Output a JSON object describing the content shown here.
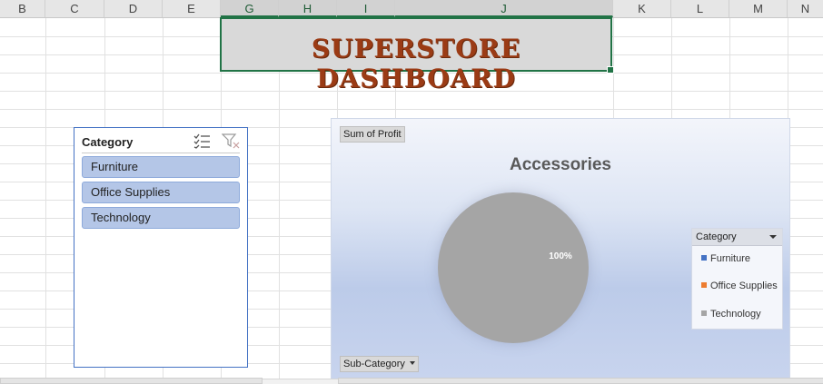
{
  "columns": [
    "B",
    "C",
    "D",
    "E",
    "G",
    "H",
    "I",
    "J",
    "K",
    "L",
    "M",
    "N"
  ],
  "selected_columns": [
    "G",
    "H",
    "I",
    "J"
  ],
  "title": "SUPERSTORE DASHBOARD",
  "slicer": {
    "header": "Category",
    "icons": [
      "multi-select-icon",
      "clear-filter-icon"
    ],
    "items": [
      "Furniture",
      "Office Supplies",
      "Technology"
    ]
  },
  "chart": {
    "value_field": "Sum of Profit",
    "axis_field": "Sub-Category",
    "legend_header": "Category",
    "pie_label": "100%",
    "series_colors": [
      "#4472c4",
      "#ed7d31",
      "#a5a5a5"
    ]
  },
  "chart_data": {
    "type": "pie",
    "title": "Accessories",
    "categories": [
      "Furniture",
      "Office Supplies",
      "Technology"
    ],
    "values": [
      0,
      0,
      100
    ],
    "data_labels": [
      "",
      "",
      "100%"
    ],
    "legend_title": "Category",
    "legend_position": "right"
  },
  "colors": {
    "title_text": "#9b3b15",
    "title_fill": "#d9d9d9",
    "selection_border": "#217346",
    "slicer_item_fill": "#b4c6e7",
    "pie_fill": "#a5a5a5"
  }
}
